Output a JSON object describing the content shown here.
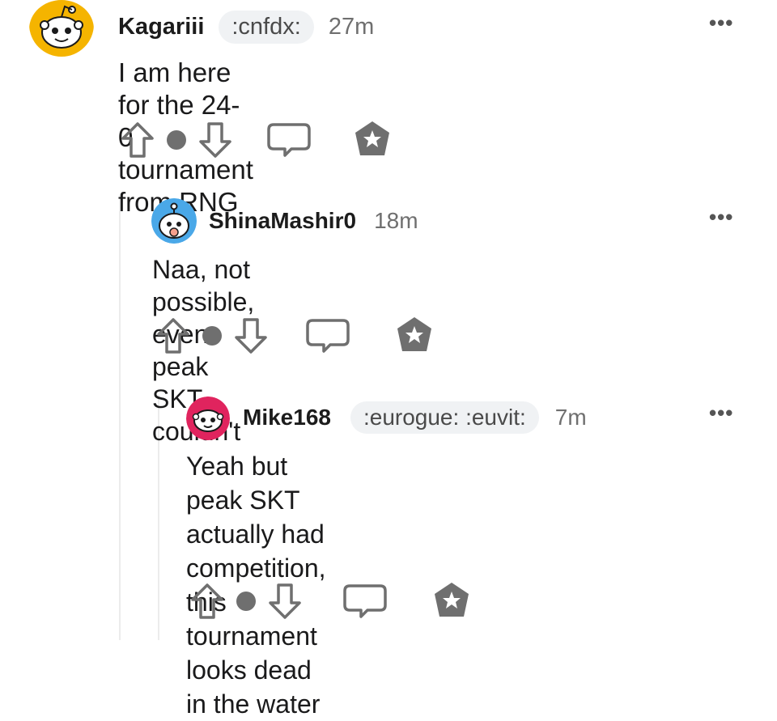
{
  "comments": [
    {
      "username": "Kagariii",
      "flair": ":cnfdx:",
      "time": "27m",
      "body": "I am here for the 24-0 tournament from RNG",
      "avatar_color": "#f5b400"
    },
    {
      "username": "ShinaMashir0",
      "flair": "",
      "time": "18m",
      "body": "Naa, not possible, even peak SKT couldn't",
      "avatar_color": "#4aa8e8"
    },
    {
      "username": "Mike168",
      "flair": ":eurogue: :euvit:",
      "time": "7m",
      "body": "Yeah but peak SKT actually had\ncompetition, this tournament looks dead\nin the water",
      "avatar_color": "#e0245e"
    }
  ],
  "more_label": "•••",
  "icons": [
    "snoo-avatar-icon",
    "upvote-icon",
    "vote-dot",
    "downvote-icon",
    "reply-icon",
    "award-icon",
    "more-options-icon"
  ]
}
